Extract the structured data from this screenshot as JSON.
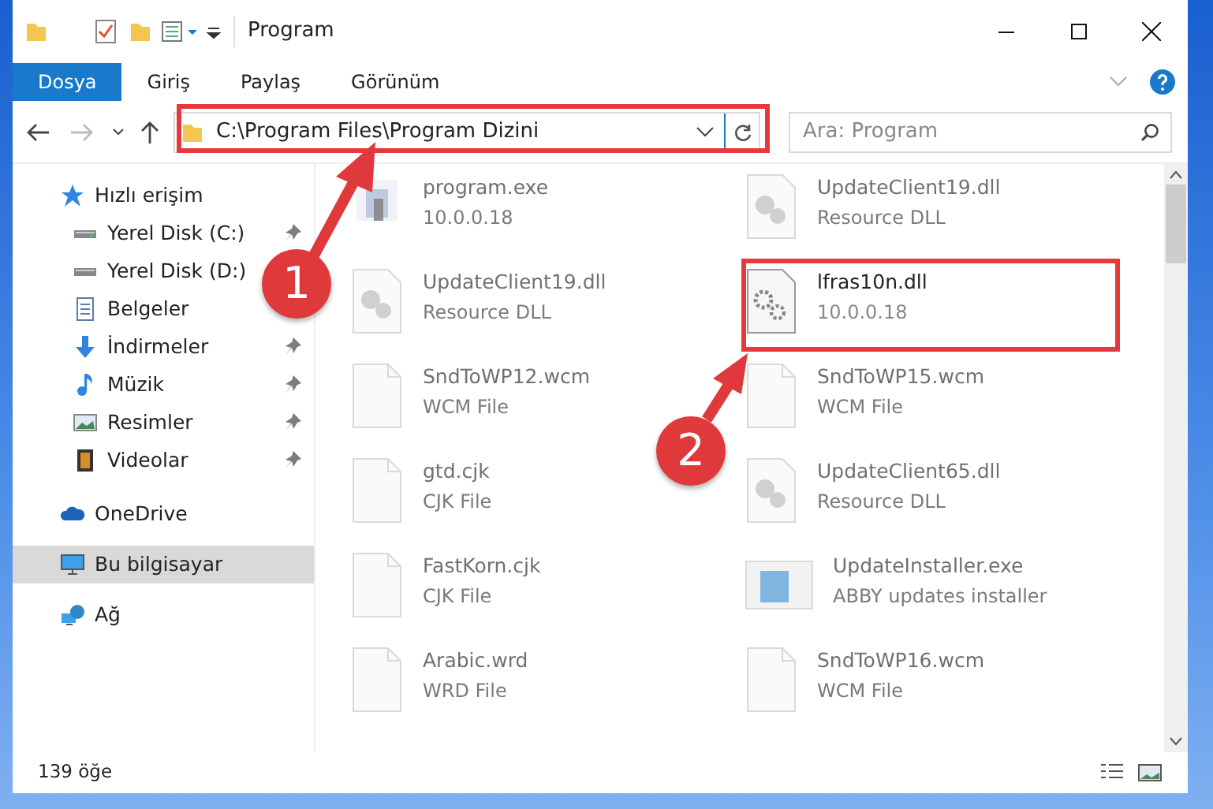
{
  "window": {
    "title": "Program"
  },
  "ribbon_tabs": [
    {
      "label": "Dosya",
      "selected": true
    },
    {
      "label": "Giriş",
      "selected": false
    },
    {
      "label": "Paylaş",
      "selected": false
    },
    {
      "label": "Görünüm",
      "selected": false
    }
  ],
  "address": {
    "path": "C:\\Program Files\\Program Dizini"
  },
  "search": {
    "placeholder": "Ara: Program"
  },
  "sidebar": {
    "items": [
      {
        "label": "Hızlı erişim",
        "kind": "star",
        "selected": false,
        "children": [
          {
            "label": "Yerel Disk (C:)",
            "kind": "drive",
            "pinned": true,
            "selected": false
          },
          {
            "label": "Yerel Disk (D:)",
            "kind": "drive",
            "pinned": false,
            "selected": false
          },
          {
            "label": "Belgeler",
            "kind": "docs",
            "pinned": false,
            "selected": false
          },
          {
            "label": "İndirmeler",
            "kind": "download",
            "pinned": true,
            "selected": false
          },
          {
            "label": "Müzik",
            "kind": "music",
            "pinned": true,
            "selected": false
          },
          {
            "label": "Resimler",
            "kind": "pictures",
            "pinned": true,
            "selected": false
          },
          {
            "label": "Videolar",
            "kind": "videos",
            "pinned": true,
            "selected": false
          }
        ]
      },
      {
        "label": "OneDrive",
        "kind": "cloud",
        "selected": false
      },
      {
        "label": "Bu bilgisayar",
        "kind": "pc",
        "selected": true
      },
      {
        "label": "Ağ",
        "kind": "network",
        "selected": false
      }
    ]
  },
  "files": [
    {
      "name": "program.exe",
      "detail": "10.0.0.18",
      "kind": "exe",
      "highlighted": false
    },
    {
      "name": "UpdateClient19.dll",
      "detail": "Resource DLL",
      "kind": "dll",
      "highlighted": false
    },
    {
      "name": "UpdateClient19.dll",
      "detail": "Resource DLL",
      "kind": "dll",
      "highlighted": false
    },
    {
      "name": "lfras10n.dll",
      "detail": "10.0.0.18",
      "kind": "gear",
      "highlighted": true
    },
    {
      "name": "SndToWP12.wcm",
      "detail": "WCM File",
      "kind": "file",
      "highlighted": false
    },
    {
      "name": "SndToWP15.wcm",
      "detail": "WCM File",
      "kind": "file",
      "highlighted": false
    },
    {
      "name": "gtd.cjk",
      "detail": "CJK File",
      "kind": "file",
      "highlighted": false
    },
    {
      "name": "UpdateClient65.dll",
      "detail": "Resource DLL",
      "kind": "dll",
      "highlighted": false
    },
    {
      "name": "FastKorn.cjk",
      "detail": "CJK File",
      "kind": "file",
      "highlighted": false
    },
    {
      "name": "UpdateInstaller.exe",
      "detail": "ABBY updates installer",
      "kind": "installer",
      "highlighted": false
    },
    {
      "name": "Arabic.wrd",
      "detail": "WRD File",
      "kind": "file",
      "highlighted": false
    },
    {
      "name": "SndToWP16.wcm",
      "detail": "WCM File",
      "kind": "file",
      "highlighted": false
    }
  ],
  "status_bar": {
    "count": "139 öğe"
  },
  "annotations": [
    {
      "label": "1"
    },
    {
      "label": "2"
    }
  ]
}
